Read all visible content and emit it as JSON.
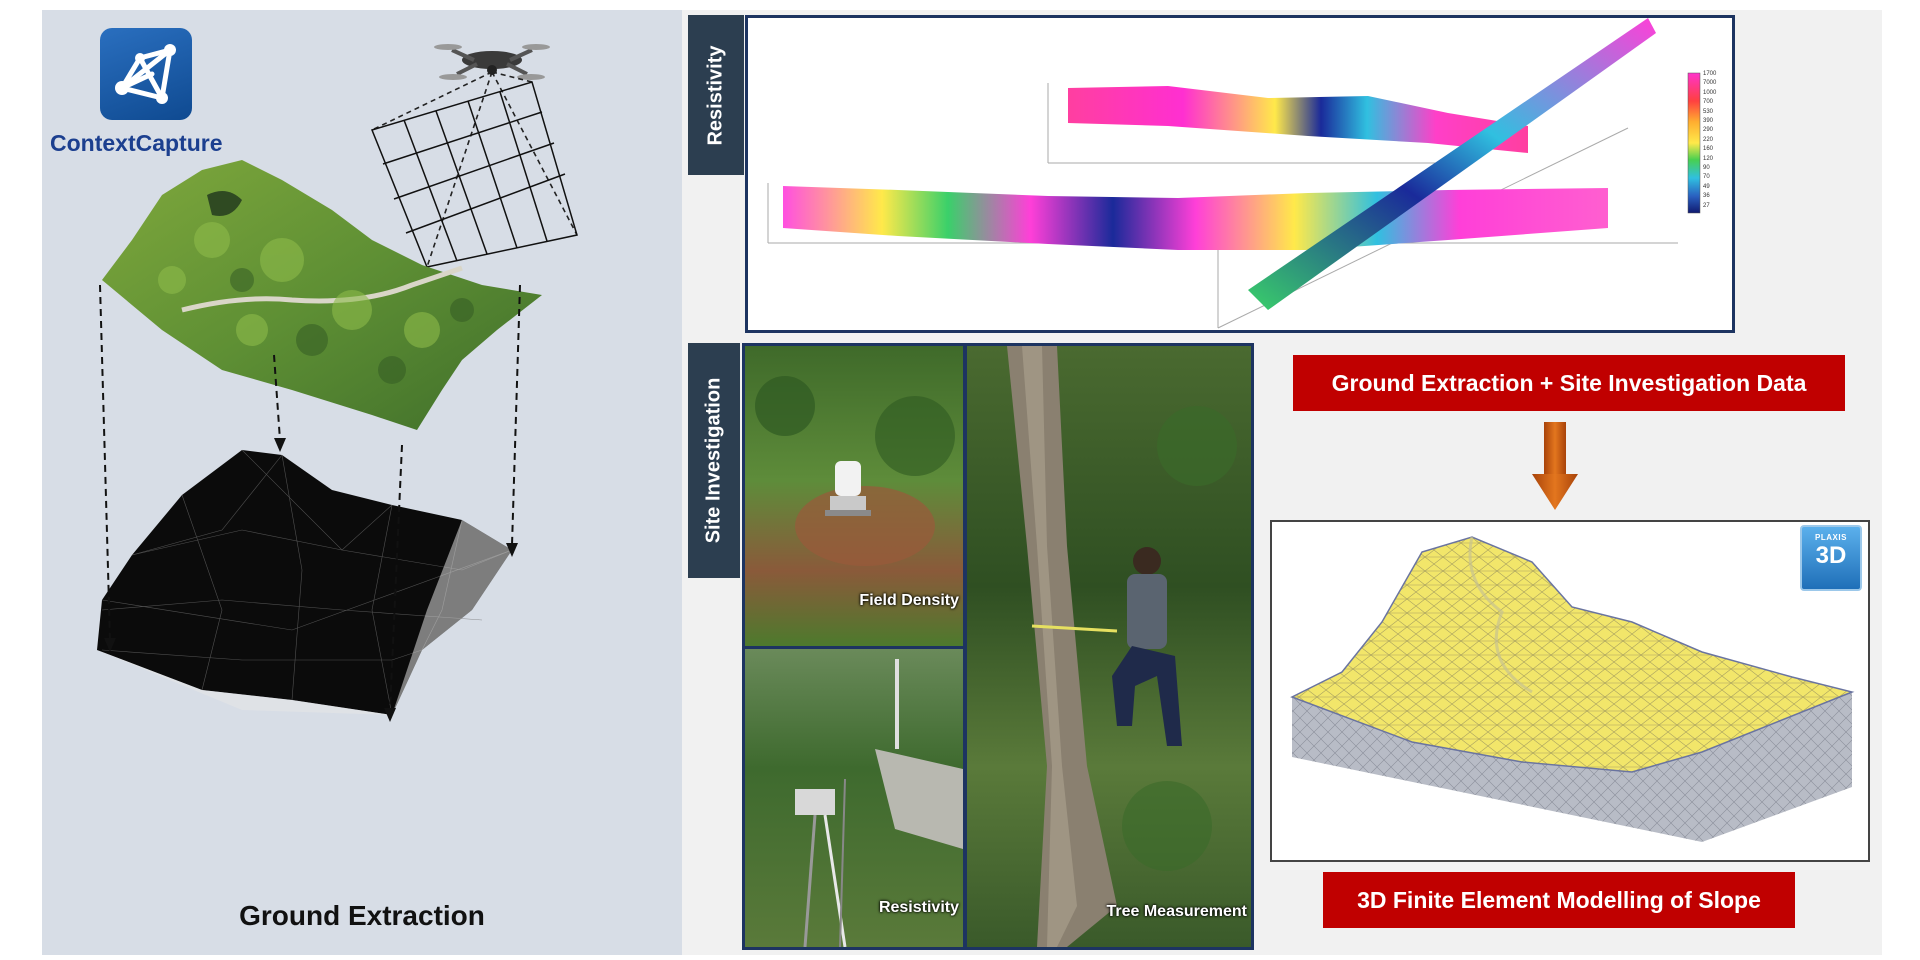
{
  "left": {
    "logo_text": "ContextCapture",
    "caption": "Ground Extraction"
  },
  "resistivity": {
    "tab_label": "Resistivity",
    "scale_ticks": [
      "1700",
      "7000",
      "1000",
      "700",
      "530",
      "390",
      "290",
      "220",
      "160",
      "120",
      "90",
      "70",
      "49",
      "36",
      "27"
    ]
  },
  "site": {
    "tab_label": "Site Investigation",
    "photos": [
      {
        "label": "Field Density"
      },
      {
        "label": "Resistivity"
      },
      {
        "label": "Tree Measurement"
      }
    ]
  },
  "flow": {
    "top_banner": "Ground Extraction + Site Investigation Data",
    "bottom_banner": "3D Finite Element Modelling of Slope"
  },
  "plaxis": {
    "badge_top": "PLAXIS",
    "badge_main": "3D"
  },
  "colors": {
    "banner_red": "#c00000",
    "navy_border": "#1d3461",
    "tab_dark": "#2c3e50",
    "logo_blue": "#1c3f8f",
    "arrow_orange": "#c85a10",
    "mesh_yellow": "#f2e66a"
  }
}
